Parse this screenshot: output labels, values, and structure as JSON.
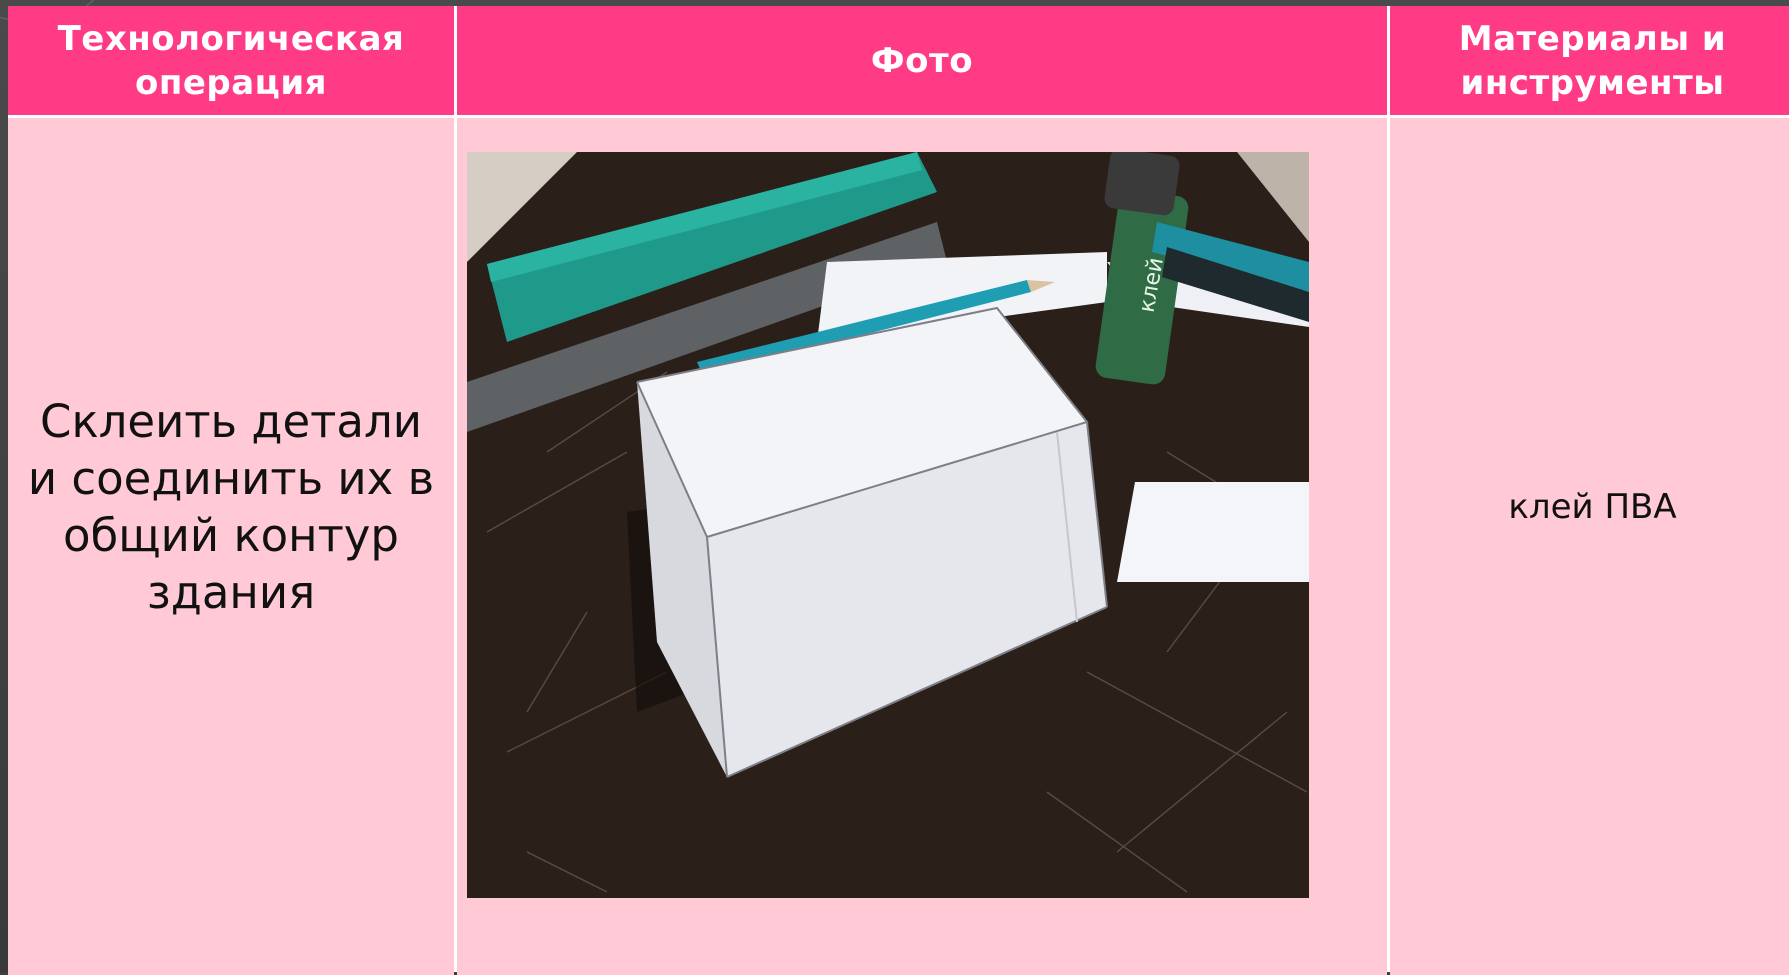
{
  "table": {
    "headers": {
      "operation": "Технологическая операция",
      "photo": "Фото",
      "materials": "Материалы и инструменты"
    },
    "row": {
      "operation": "Склеить детали и соединить их в общий контур здания",
      "materials": "клей ПВА"
    }
  },
  "photo": {
    "glue_label": "клей"
  },
  "colors": {
    "header_bg": "#ff3b86",
    "body_bg": "#ffc9d6",
    "header_text": "#ffffff",
    "slide_bg": "#3f3f3f"
  }
}
